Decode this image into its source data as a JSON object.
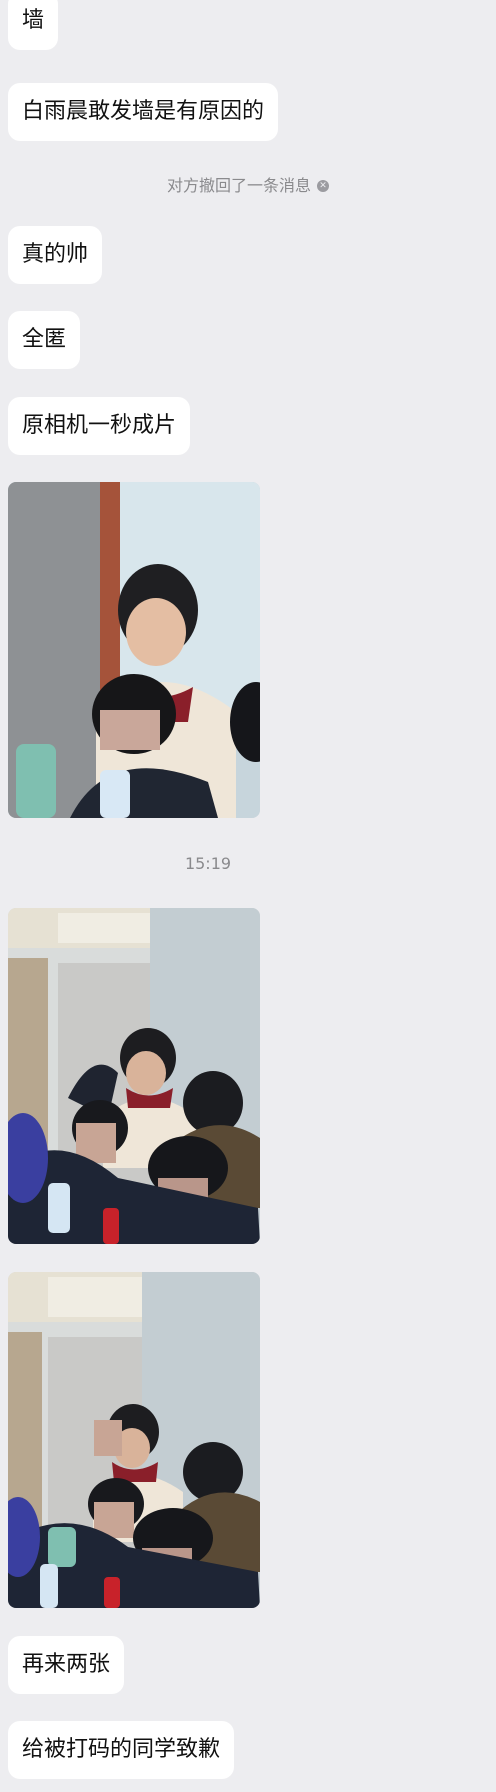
{
  "messages": [
    {
      "type": "text",
      "text": "墙"
    },
    {
      "type": "text",
      "text": "白雨晨敢发墙是有原因的"
    },
    {
      "type": "system",
      "text": "对方撤回了一条消息"
    },
    {
      "type": "text",
      "text": "真的帅"
    },
    {
      "type": "text",
      "text": "全匿"
    },
    {
      "type": "text",
      "text": "原相机一秒成片"
    },
    {
      "type": "image",
      "description": "photo"
    },
    {
      "type": "timestamp",
      "text": "15:19"
    },
    {
      "type": "image",
      "description": "photo"
    },
    {
      "type": "image",
      "description": "photo"
    },
    {
      "type": "text",
      "text": "再来两张"
    },
    {
      "type": "text",
      "text": "给被打码的同学致歉"
    }
  ],
  "icons": {
    "recall_close": "close-circle-icon"
  },
  "colors": {
    "background": "#ededf0",
    "bubble": "#ffffff",
    "system_text": "#8a8a8d"
  }
}
